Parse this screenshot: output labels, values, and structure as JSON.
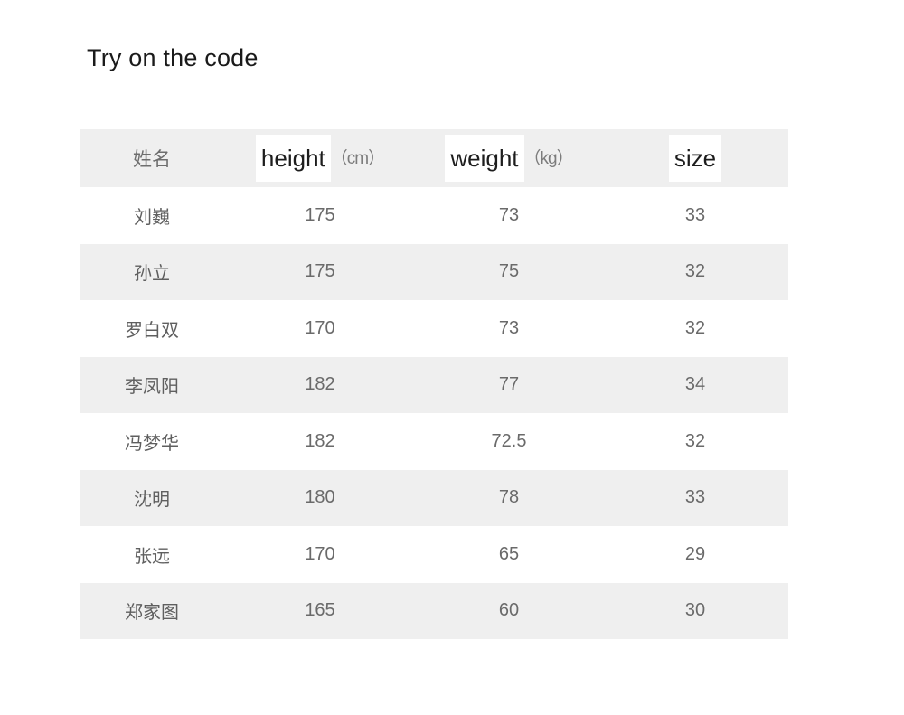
{
  "page": {
    "title": "Try on the code",
    "background_color": "#ffffff",
    "accent_row_color": "#efefef",
    "text_color": "#6a6a6a",
    "highlight_color": "#ffffff"
  },
  "table": {
    "columns": [
      {
        "key": "name",
        "label": "姓名",
        "highlight": "",
        "unit": ""
      },
      {
        "key": "height",
        "label": "height（cm）",
        "highlight": "height",
        "unit": "（cm）"
      },
      {
        "key": "weight",
        "label": "weight（kg）",
        "highlight": "weight",
        "unit": "（kg）"
      },
      {
        "key": "size",
        "label": "size",
        "highlight": "size",
        "unit": ""
      }
    ],
    "rows": [
      {
        "name": "刘巍",
        "height": "175",
        "weight": "73",
        "size": "33"
      },
      {
        "name": "孙立",
        "height": "175",
        "weight": "75",
        "size": "32"
      },
      {
        "name": "罗白双",
        "height": "170",
        "weight": "73",
        "size": "32"
      },
      {
        "name": "李凤阳",
        "height": "182",
        "weight": "77",
        "size": "34"
      },
      {
        "name": "冯梦华",
        "height": "182",
        "weight": "72.5",
        "size": "32"
      },
      {
        "name": "沈明",
        "height": "180",
        "weight": "78",
        "size": "33"
      },
      {
        "name": "张远",
        "height": "170",
        "weight": "65",
        "size": "29"
      },
      {
        "name": "郑家图",
        "height": "165",
        "weight": "60",
        "size": "30"
      }
    ]
  }
}
